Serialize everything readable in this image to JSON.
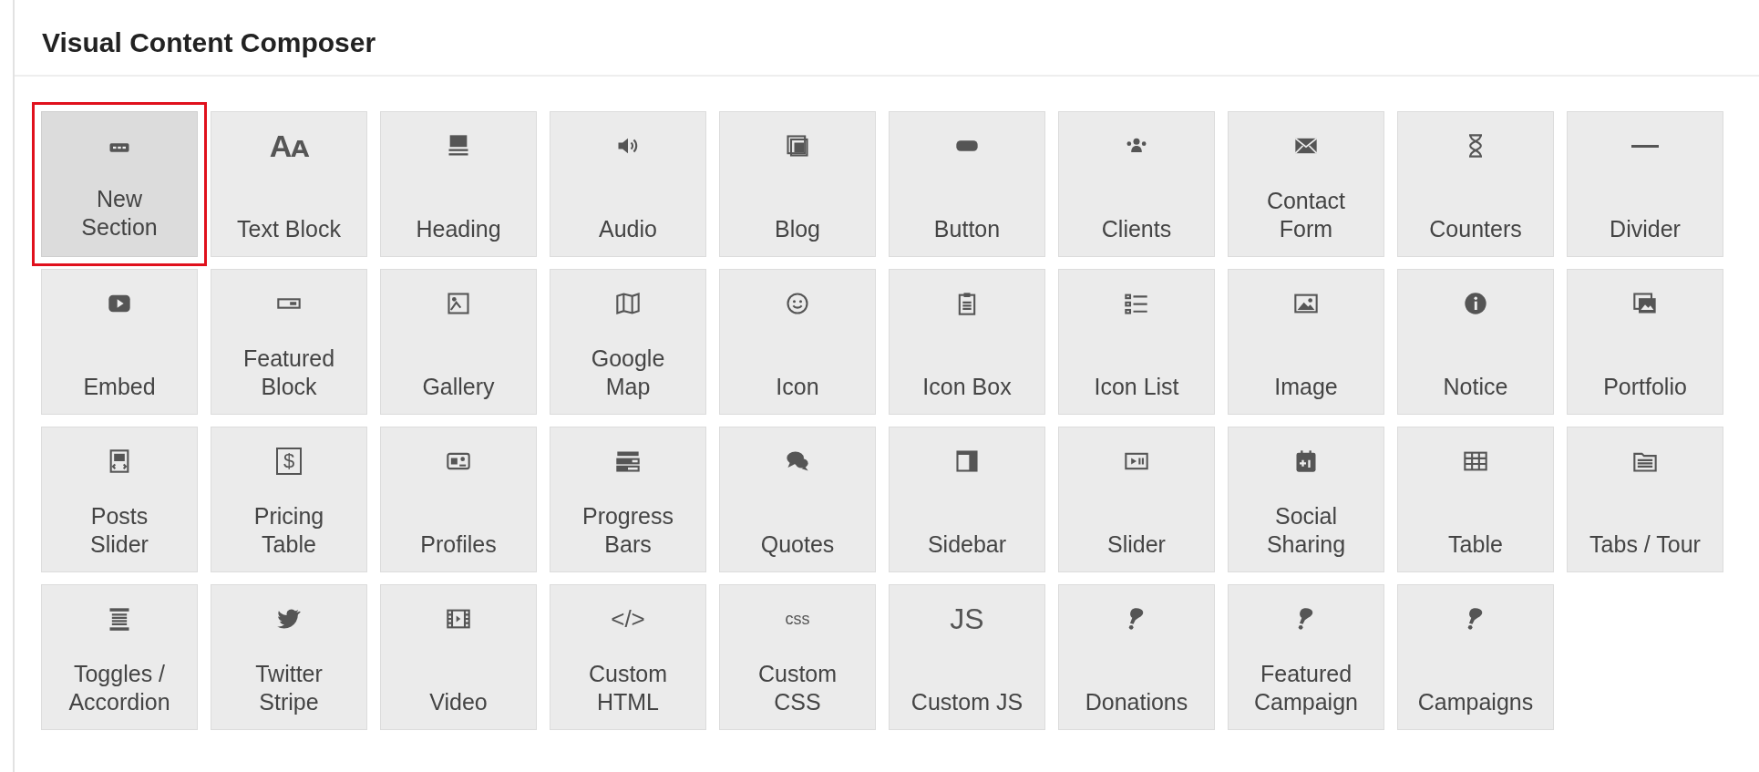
{
  "panel": {
    "title": "Visual Content Composer"
  },
  "elements": [
    {
      "label": "New Section",
      "selected": true
    },
    {
      "label": "Text Block",
      "glyph": "Aᴀ",
      "selected": false
    },
    {
      "label": "Heading",
      "selected": false
    },
    {
      "label": "Audio",
      "selected": false
    },
    {
      "label": "Blog",
      "selected": false
    },
    {
      "label": "Button",
      "selected": false
    },
    {
      "label": "Clients",
      "selected": false
    },
    {
      "label": "Contact Form",
      "selected": false
    },
    {
      "label": "Counters",
      "selected": false
    },
    {
      "label": "Divider",
      "selected": false
    },
    {
      "label": "Embed",
      "selected": false
    },
    {
      "label": "Featured Block",
      "selected": false
    },
    {
      "label": "Gallery",
      "selected": false
    },
    {
      "label": "Google Map",
      "selected": false
    },
    {
      "label": "Icon",
      "selected": false
    },
    {
      "label": "Icon Box",
      "selected": false
    },
    {
      "label": "Icon List",
      "selected": false
    },
    {
      "label": "Image",
      "selected": false
    },
    {
      "label": "Notice",
      "selected": false
    },
    {
      "label": "Portfolio",
      "selected": false
    },
    {
      "label": "Posts Slider",
      "selected": false
    },
    {
      "label": "Pricing Table",
      "glyph": "$",
      "selected": false
    },
    {
      "label": "Profiles",
      "selected": false
    },
    {
      "label": "Progress Bars",
      "selected": false
    },
    {
      "label": "Quotes",
      "selected": false
    },
    {
      "label": "Sidebar",
      "selected": false
    },
    {
      "label": "Slider",
      "selected": false
    },
    {
      "label": "Social Sharing",
      "selected": false
    },
    {
      "label": "Table",
      "selected": false
    },
    {
      "label": "Tabs / Tour",
      "selected": false
    },
    {
      "label": "Toggles / Accordion",
      "selected": false
    },
    {
      "label": "Twitter Stripe",
      "selected": false
    },
    {
      "label": "Video",
      "selected": false
    },
    {
      "label": "Custom HTML",
      "glyph": "</>",
      "selected": false
    },
    {
      "label": "Custom CSS",
      "glyph": "css",
      "selected": false
    },
    {
      "label": "Custom JS",
      "glyph": "JS",
      "selected": false
    },
    {
      "label": "Donations",
      "selected": false
    },
    {
      "label": "Featured Campaign",
      "selected": false
    },
    {
      "label": "Campaigns",
      "selected": false
    }
  ]
}
